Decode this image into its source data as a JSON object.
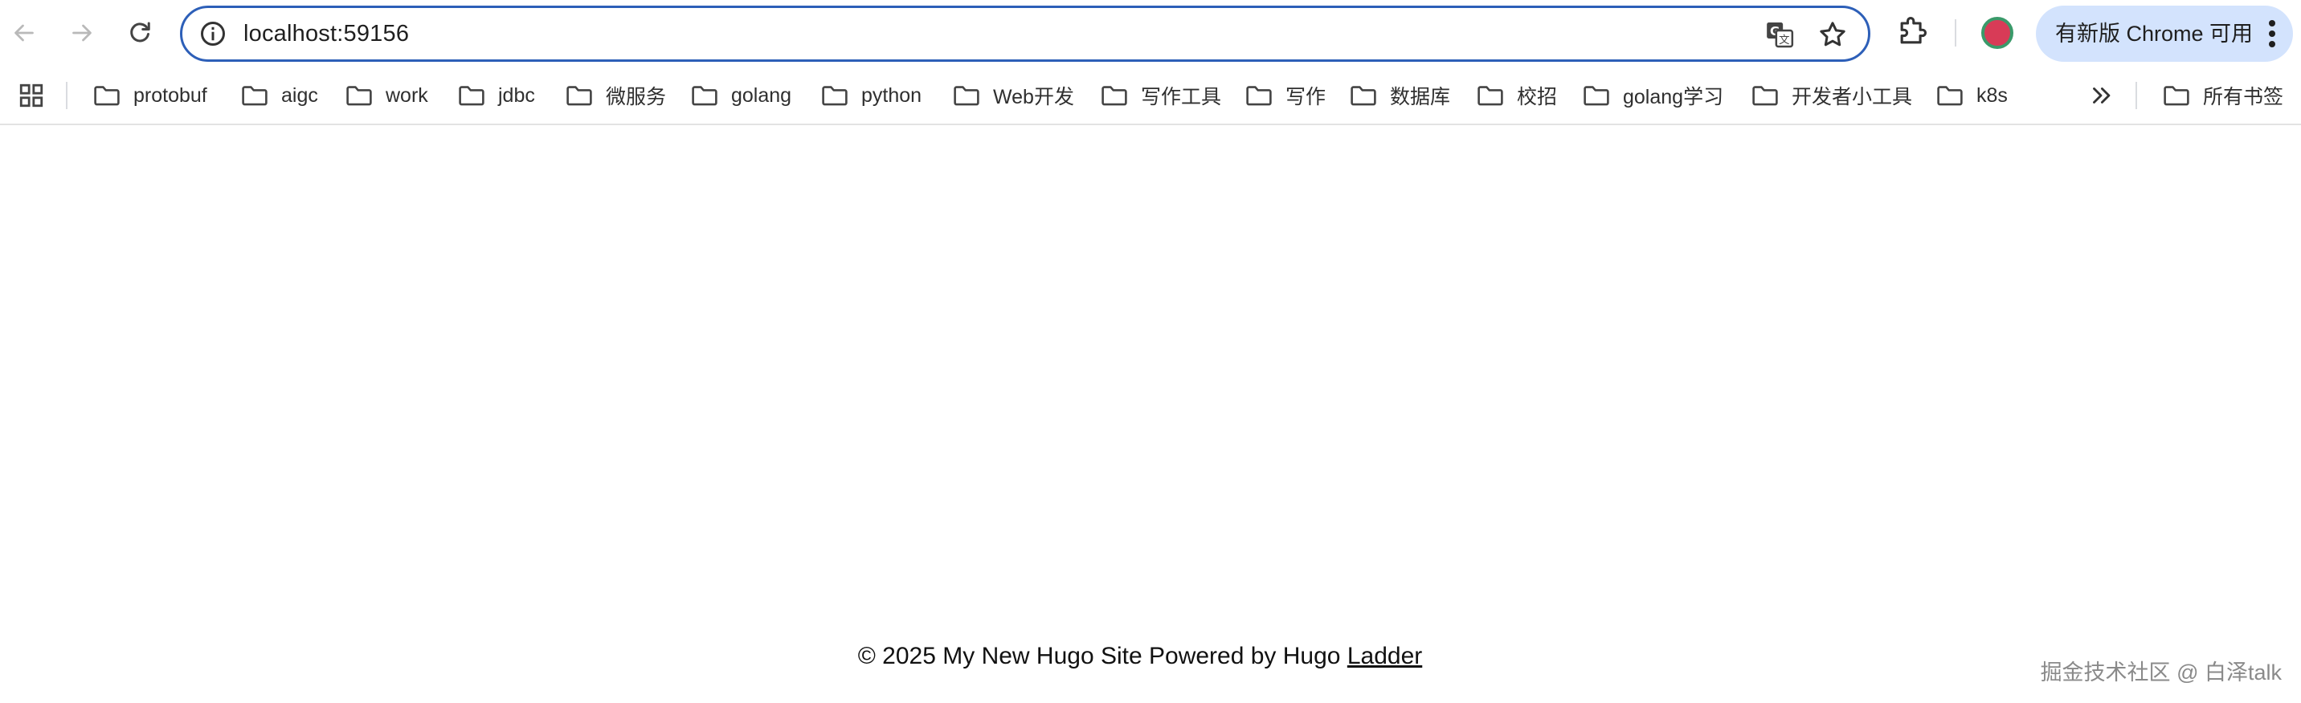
{
  "browser": {
    "address_bar": {
      "url": "localhost:59156"
    },
    "update_button": {
      "label": "有新版 Chrome 可用"
    },
    "icons": {
      "back": "arrow-left-icon",
      "forward": "arrow-right-icon",
      "reload": "reload-icon",
      "site_info": "info-icon",
      "translate": "translate-icon",
      "bookmark_star": "star-icon",
      "extensions": "puzzle-icon",
      "menu": "kebab-menu-icon"
    }
  },
  "bookmarks_bar": {
    "items": [
      {
        "label": "protobuf"
      },
      {
        "label": "aigc"
      },
      {
        "label": "work"
      },
      {
        "label": "jdbc"
      },
      {
        "label": "微服务"
      },
      {
        "label": "golang"
      },
      {
        "label": "python"
      },
      {
        "label": "Web开发"
      },
      {
        "label": "写作工具"
      },
      {
        "label": "写作"
      },
      {
        "label": "数据库"
      },
      {
        "label": "校招"
      },
      {
        "label": "golang学习"
      },
      {
        "label": "开发者小工具"
      },
      {
        "label": "k8s"
      }
    ],
    "all_bookmarks": {
      "label": "所有书签"
    }
  },
  "page": {
    "footer": {
      "copyright": "© 2025 My New Hugo Site Powered by Hugo",
      "theme_link": "Ladder"
    },
    "watermark": "掘金技术社区 @ 白泽talk"
  },
  "colors": {
    "omnibox_border": "#2d5fb8",
    "update_pill_bg": "#d3e3fd",
    "profile_fill": "#d83b57",
    "profile_ring": "#3a9a6a"
  }
}
